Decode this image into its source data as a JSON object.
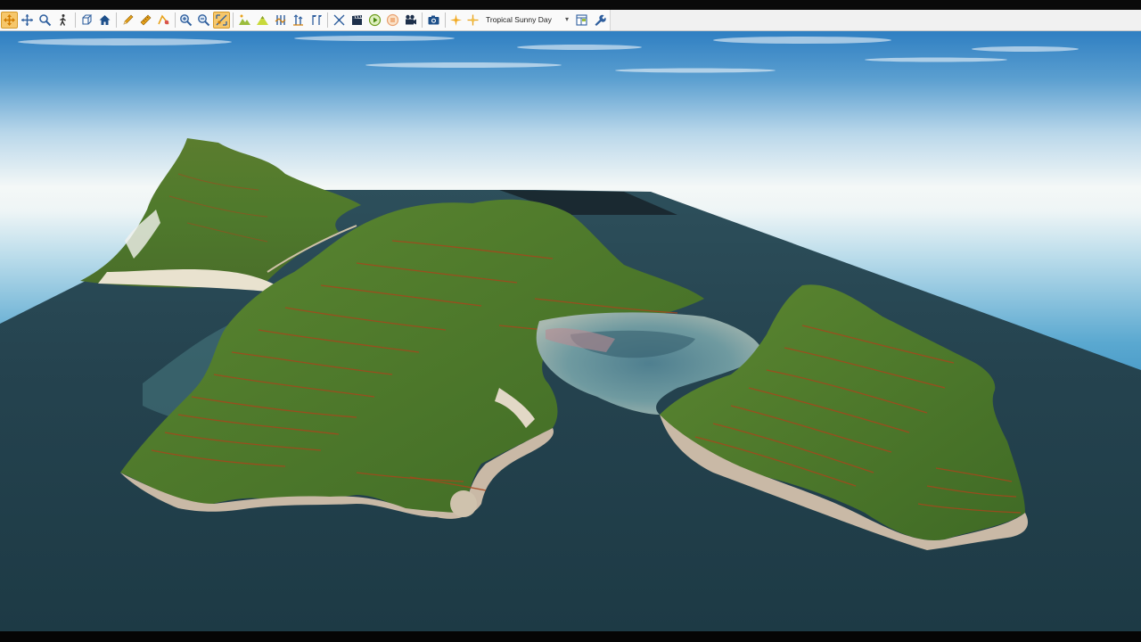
{
  "toolbar": {
    "tools": [
      {
        "name": "select-pan-tool",
        "icon": "pan-arrows-icon",
        "active": true
      },
      {
        "name": "move-tool",
        "icon": "move-arrows-icon",
        "active": false
      },
      {
        "name": "zoom-tool",
        "icon": "magnifier-icon",
        "active": false
      },
      {
        "name": "walk-tool",
        "icon": "walking-person-icon",
        "active": false
      },
      {
        "name": "perspective-view",
        "icon": "cube-icon",
        "active": false
      },
      {
        "name": "home-view",
        "icon": "home-icon",
        "active": false
      },
      {
        "name": "edit-tool",
        "icon": "pencil-icon",
        "active": false
      },
      {
        "name": "measure-tool",
        "icon": "ruler-icon",
        "active": false
      },
      {
        "name": "measure-angle-tool",
        "icon": "protractor-icon",
        "active": false
      },
      {
        "name": "zoom-in",
        "icon": "zoom-in-icon",
        "active": false
      },
      {
        "name": "zoom-out",
        "icon": "zoom-out-icon",
        "active": false
      },
      {
        "name": "zoom-extents",
        "icon": "zoom-extents-icon",
        "active": true
      },
      {
        "name": "terrain-tool",
        "icon": "terrain-icon",
        "active": false
      },
      {
        "name": "mountain-tool",
        "icon": "mountain-icon",
        "active": false
      },
      {
        "name": "profile-tool",
        "icon": "profile-icon",
        "active": false
      },
      {
        "name": "elevation-tool",
        "icon": "elevation-icon",
        "active": false
      },
      {
        "name": "flag-tool",
        "icon": "flag-icon",
        "active": false
      },
      {
        "name": "fly-tool",
        "icon": "airplane-icon",
        "active": false
      },
      {
        "name": "record-tool",
        "icon": "clapperboard-icon",
        "active": false
      },
      {
        "name": "play-button",
        "icon": "play-icon",
        "active": false
      },
      {
        "name": "stop-button",
        "icon": "stop-icon",
        "active": false
      },
      {
        "name": "camera-tool",
        "icon": "movie-camera-icon",
        "active": false
      },
      {
        "name": "screenshot-button",
        "icon": "camera-icon",
        "active": false
      },
      {
        "name": "sun-tool",
        "icon": "sun-icon",
        "active": false
      },
      {
        "name": "light-tool",
        "icon": "light-icon",
        "active": false
      }
    ],
    "environment_preset": "Tropical Sunny Day",
    "after_preset_tools": [
      {
        "name": "layers-panel-button",
        "icon": "panel-icon"
      },
      {
        "name": "settings-button",
        "icon": "wrench-icon"
      }
    ]
  },
  "colors": {
    "sky_top": "#2f7fc2",
    "sky_horizon": "#f4f8f7",
    "ocean_far": "#3f97c4",
    "sea_near": "#223f4c",
    "terrain_green": "#4f7a2c",
    "contour_lines": "#a8461c",
    "rock": "#c9b9a6",
    "toolbar_active": "#f6c76b"
  }
}
